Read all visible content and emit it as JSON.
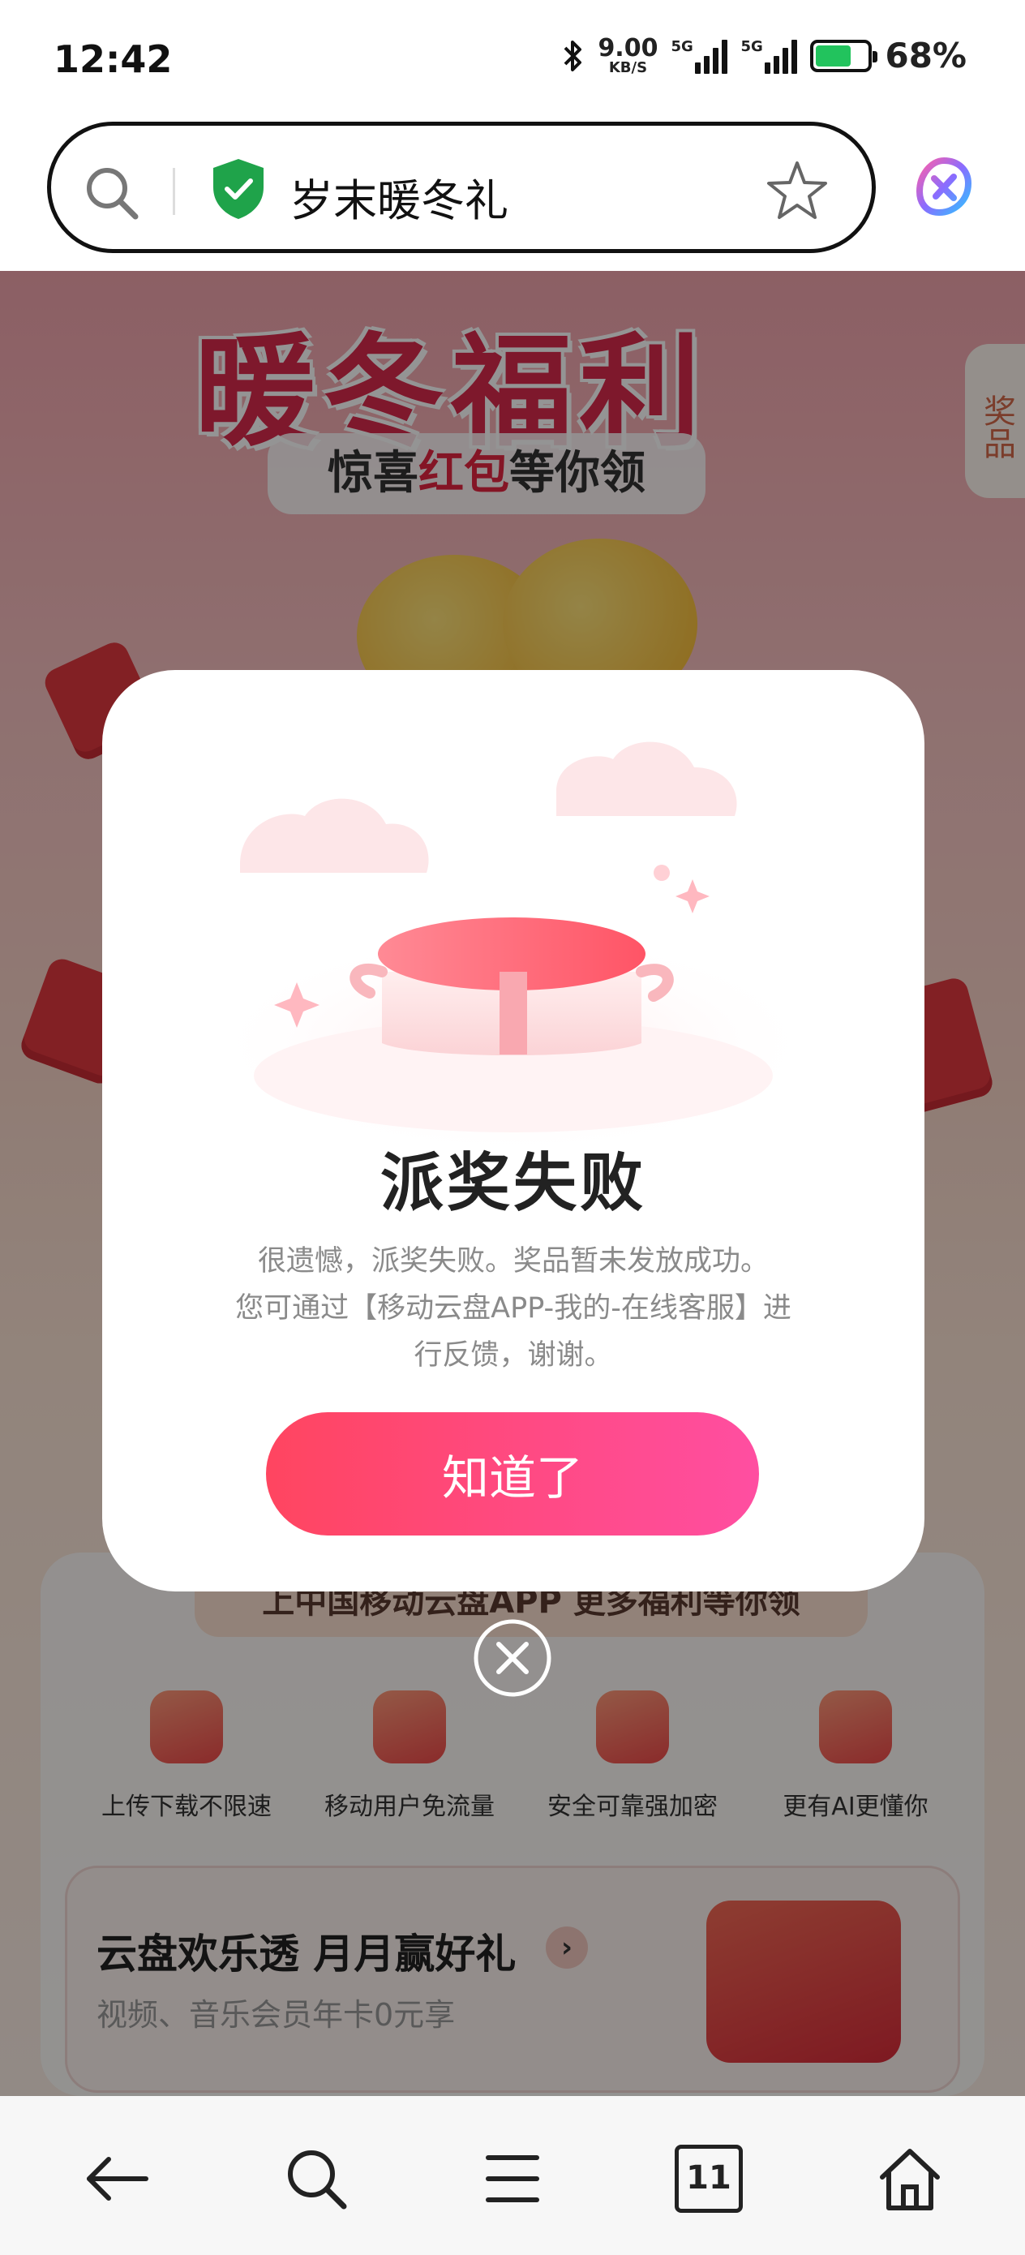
{
  "status_bar": {
    "time": "12:42",
    "net_speed_value": "9.00",
    "net_speed_unit": "KB/S",
    "signal1_tag": "5G",
    "signal2_tag": "5G",
    "battery_text": "68%",
    "battery_level": 0.68
  },
  "address_bar": {
    "page_title": "岁末暖冬礼",
    "secure": true
  },
  "background_page": {
    "banner_title": "暖冬福利",
    "banner_sub_pre": "惊喜",
    "banner_sub_red": "红包",
    "banner_sub_post": "等你领",
    "side_tab": "奖品",
    "card_head": "上中国移动云盘APP 更多福利等你领",
    "features": [
      {
        "label": "上传下载不限速",
        "icon": "rocket-icon"
      },
      {
        "label": "移动用户免流量",
        "icon": "data-drop-icon"
      },
      {
        "label": "安全可靠强加密",
        "icon": "shield-check-icon"
      },
      {
        "label": "更有AI更懂你",
        "icon": "ai-icon"
      }
    ],
    "promo_title": "云盘欢乐透 月月赢好礼",
    "promo_sub": "视频、音乐会员年卡0元享",
    "promo_arrow": "›"
  },
  "modal": {
    "title": "派奖失败",
    "description_lines": [
      "很遗憾，派奖失败。奖品暂未发放成功。",
      "您可通过【移动云盘APP-我的-在线客服】进",
      "行反馈，谢谢。"
    ],
    "button_label": "知道了"
  },
  "bottom_nav": {
    "tab_count": "11",
    "items": [
      "back-icon",
      "search-icon",
      "menu-icon",
      "tabs-icon",
      "home-icon"
    ]
  },
  "colors": {
    "accent_start": "#ff4560",
    "accent_end": "#ff4ea1",
    "secure_green": "#1fa34a"
  }
}
